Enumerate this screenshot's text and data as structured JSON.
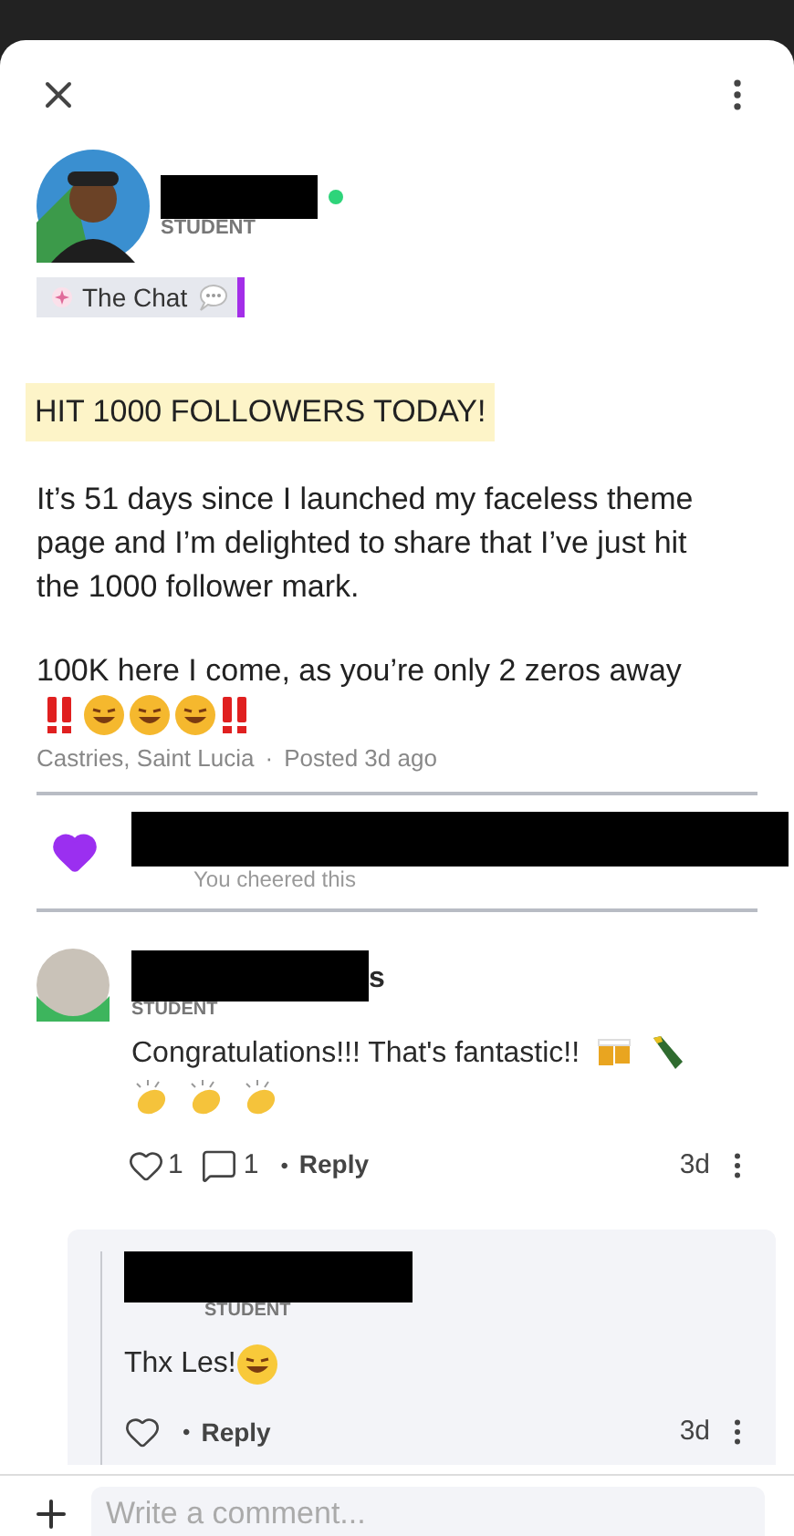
{
  "post": {
    "author_role": "STUDENT",
    "online": true,
    "tag": "The Chat",
    "headline": "HIT 1000 FOLLOWERS TODAY!",
    "paragraphs": [
      "It’s 51 days since I launched my faceless theme page and I’m delighted to share that I’ve just hit the 1000 follower mark.",
      "100K here I come, as you’re only 2 zeros away"
    ],
    "location": "Castries, Saint Lucia",
    "separator": "·",
    "posted": "Posted 3d ago"
  },
  "cheers": {
    "cheered": true,
    "text": "You cheered this"
  },
  "comments": [
    {
      "name_tail": "s",
      "role": "STUDENT",
      "text": "Congratulations!!! That's fantastic!!",
      "likes": "1",
      "replies_count": "1",
      "bullet": "•",
      "reply": "Reply",
      "time": "3d",
      "replies": [
        {
          "role": "STUDENT",
          "text": "Thx Les!",
          "bullet": "•",
          "reply": "Reply",
          "time": "3d"
        }
      ]
    }
  ],
  "composer": {
    "placeholder": "Write a comment..."
  }
}
